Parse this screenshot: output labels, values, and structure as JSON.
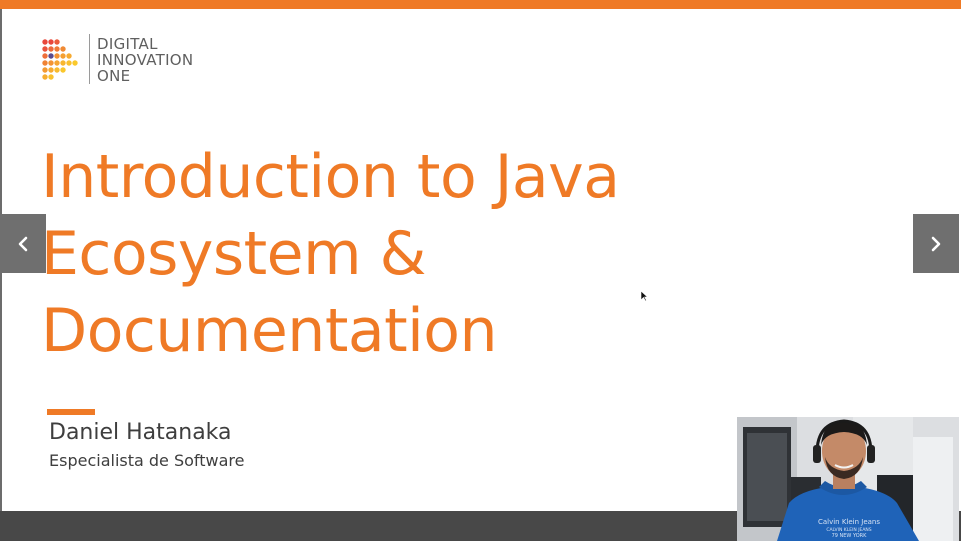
{
  "brand": {
    "logo_lines": [
      "DIGITAL",
      "INNOVATION",
      "ONE"
    ],
    "accent_color": "#ef7a26"
  },
  "slide": {
    "title_lines": [
      "Introduction to Java",
      "Ecosystem &",
      "Documentation"
    ],
    "presenter_name": "Daniel Hatanaka",
    "presenter_role": "Especialista de Software"
  },
  "navigation": {
    "prev_icon": "chevron-left-icon",
    "next_icon": "chevron-right-icon"
  },
  "webcam": {
    "shirt_text_lines": [
      "Calvin Klein Jeans",
      "CALVIN KLEIN JEANS",
      "79 NEW YORK"
    ]
  },
  "colors": {
    "accent": "#ef7a26",
    "text": "#3e3e3e",
    "bottom_bar": "#484848",
    "nav_button": "#6f6f6f"
  }
}
